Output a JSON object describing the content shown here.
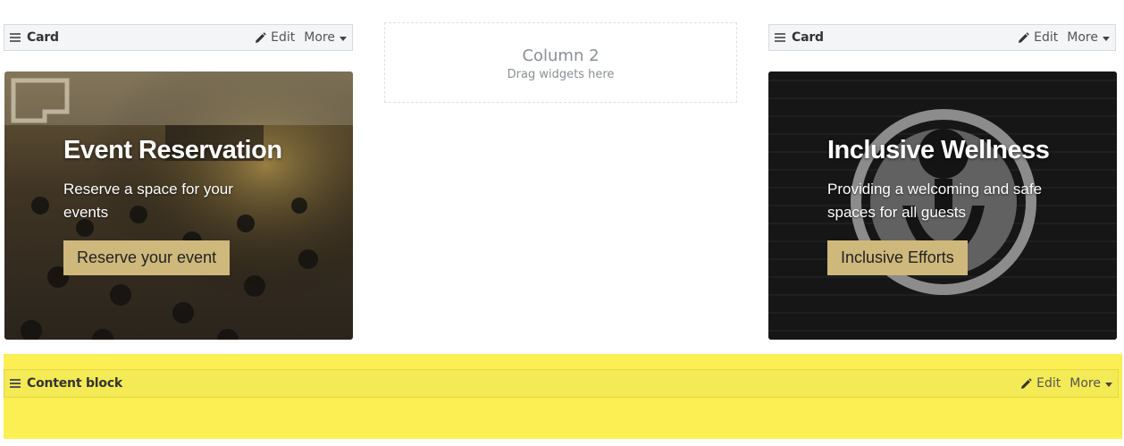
{
  "card1": {
    "bar": {
      "title": "Card",
      "edit_label": "Edit",
      "more_label": "More"
    },
    "heading": "Event Reservation",
    "text": "Reserve a space for your events",
    "button": "Reserve your event"
  },
  "column2": {
    "title": "Column 2",
    "hint": "Drag widgets here"
  },
  "card2": {
    "bar": {
      "title": "Card",
      "edit_label": "Edit",
      "more_label": "More"
    },
    "heading": "Inclusive Wellness",
    "text": "Providing a welcoming and safe spaces for all guests",
    "button": "Inclusive Efforts"
  },
  "content_block": {
    "bar": {
      "title": "Content block",
      "edit_label": "Edit",
      "more_label": "More"
    }
  },
  "colors": {
    "button_gold": "#cfb87c",
    "highlight_yellow": "#fbef54"
  },
  "icons": {
    "handle": "drag-handle-icon",
    "edit": "pencil-icon",
    "more": "caret-down-icon"
  }
}
